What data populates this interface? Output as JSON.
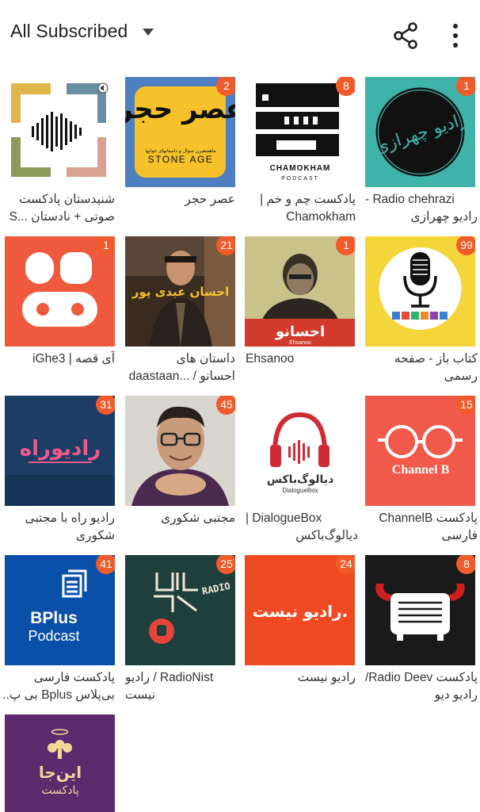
{
  "header": {
    "title": "All Subscribed",
    "share_icon": "share-icon",
    "menu_icon": "more-vert-icon"
  },
  "accent": "#ef5b2b",
  "podcasts": [
    {
      "line1": "شنیدستان پادکست",
      "line2": "صوتی + نادستان ...S",
      "badge": ""
    },
    {
      "line1": "عصر حجر",
      "line2": "",
      "badge": "2",
      "art_title": "عصر حجر",
      "art_sub": "STONE AGE",
      "art_tag": "ماهمتعبرن سوال و داستانهای جوابها"
    },
    {
      "line1": "پادکست چم و خم |",
      "line2": "Chamokham",
      "badge": "8",
      "art_title": "CHAMOKHAM",
      "art_sub": "PODCAST"
    },
    {
      "line1": "- Radio chehrazi",
      "line2": "رادیو چهرازی",
      "badge": "1",
      "art_title": "رادیو چهرازی"
    },
    {
      "line1": "آی قصه | iGhe3",
      "line2": "",
      "badge": "1",
      "art_title": "آی قصه"
    },
    {
      "line1": "داستان های",
      "line2": "احسانو / ...daastaan",
      "badge": "21",
      "art_title": "احسان عبدی پور"
    },
    {
      "line1": "Ehsanoo",
      "line2": "",
      "badge": "1",
      "art_title": "احسانو",
      "art_sub": "Ehsanoo"
    },
    {
      "line1": "کتاب باز - صفحه",
      "line2": "رسمی",
      "badge": "99",
      "art_title": "کتاب باز"
    },
    {
      "line1": "رادیو راه با مجتبی",
      "line2": "شکوری",
      "badge": "31",
      "art_title": "رادیوراه"
    },
    {
      "line1": "مجتبی شکوری",
      "line2": "",
      "badge": "45"
    },
    {
      "line1": "| DialogueBox",
      "line2": "دیالوگ‌باکس",
      "badge": "",
      "art_title": "دیالوگ‌باکس",
      "art_sub": "DialogueBox"
    },
    {
      "line1": "پادکست ChannelB",
      "line2": "فارسی",
      "badge": "15",
      "art_title": "Channel B"
    },
    {
      "line1": "پادکست فارسی",
      "line2": "بی‌پلاس Bplus بی پ..",
      "badge": "41",
      "art_title": "BPlus",
      "art_sub": "Podcast"
    },
    {
      "line1": "رادیو / RadioNist",
      "line2": "نیست",
      "badge": "25",
      "art_title": "RADIO NIST"
    },
    {
      "line1": "رادیو نیست",
      "line2": "",
      "badge": "24",
      "art_title": "رادیو نیست."
    },
    {
      "line1": "/Radio Deev پادکست",
      "line2": "رادیو دیو",
      "badge": "8"
    },
    {
      "line1": "",
      "line2": "",
      "badge": "",
      "art_title": "این‌جا",
      "art_sub": "پادکست"
    }
  ]
}
